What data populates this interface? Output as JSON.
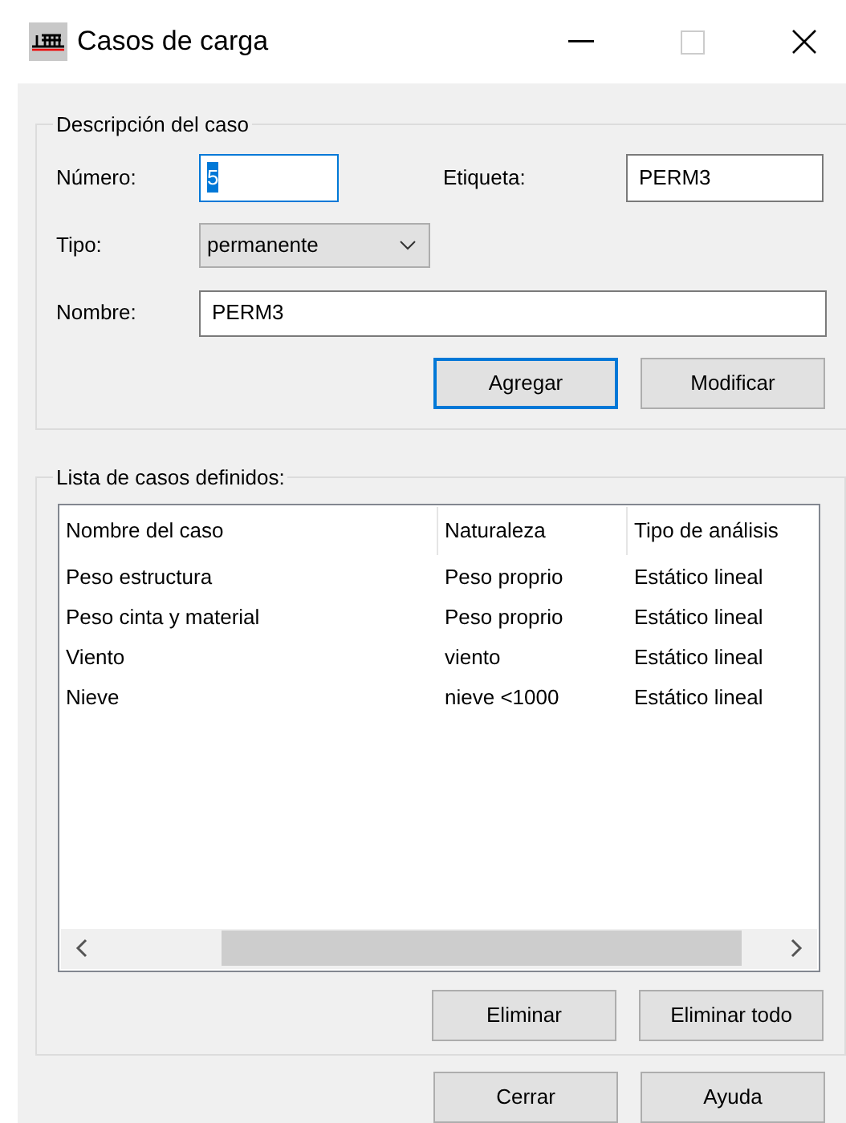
{
  "window": {
    "title": "Casos de carga"
  },
  "description": {
    "title": "Descripción del caso",
    "numero": {
      "label": "Número:",
      "value": "5",
      "focused": true
    },
    "etiqueta": {
      "label": "Etiqueta:",
      "value": "PERM3"
    },
    "tipo": {
      "label": "Tipo:",
      "value": "permanente"
    },
    "nombre": {
      "label": "Nombre:",
      "value": "PERM3"
    },
    "buttons": [
      {
        "label": "Agregar",
        "default": true
      },
      {
        "label": "Modificar",
        "default": false
      }
    ]
  },
  "list": {
    "title": "Lista de casos definidos:",
    "columns": [
      "Nombre del caso",
      "Naturaleza",
      "Tipo de análisis"
    ],
    "rows": [
      [
        "Peso estructura",
        "Peso proprio",
        "Estático lineal"
      ],
      [
        "Peso cinta y material",
        "Peso proprio",
        "Estático lineal"
      ],
      [
        "Viento",
        "viento",
        "Estático lineal"
      ],
      [
        "Nieve",
        "nieve <1000",
        "Estático lineal"
      ]
    ],
    "buttons": [
      {
        "label": "Eliminar",
        "default": false
      },
      {
        "label": "Eliminar todo",
        "default": false
      }
    ]
  },
  "buttons": [
    {
      "label": "Cerrar",
      "default": false
    },
    {
      "label": "Ayuda",
      "default": false
    }
  ]
}
